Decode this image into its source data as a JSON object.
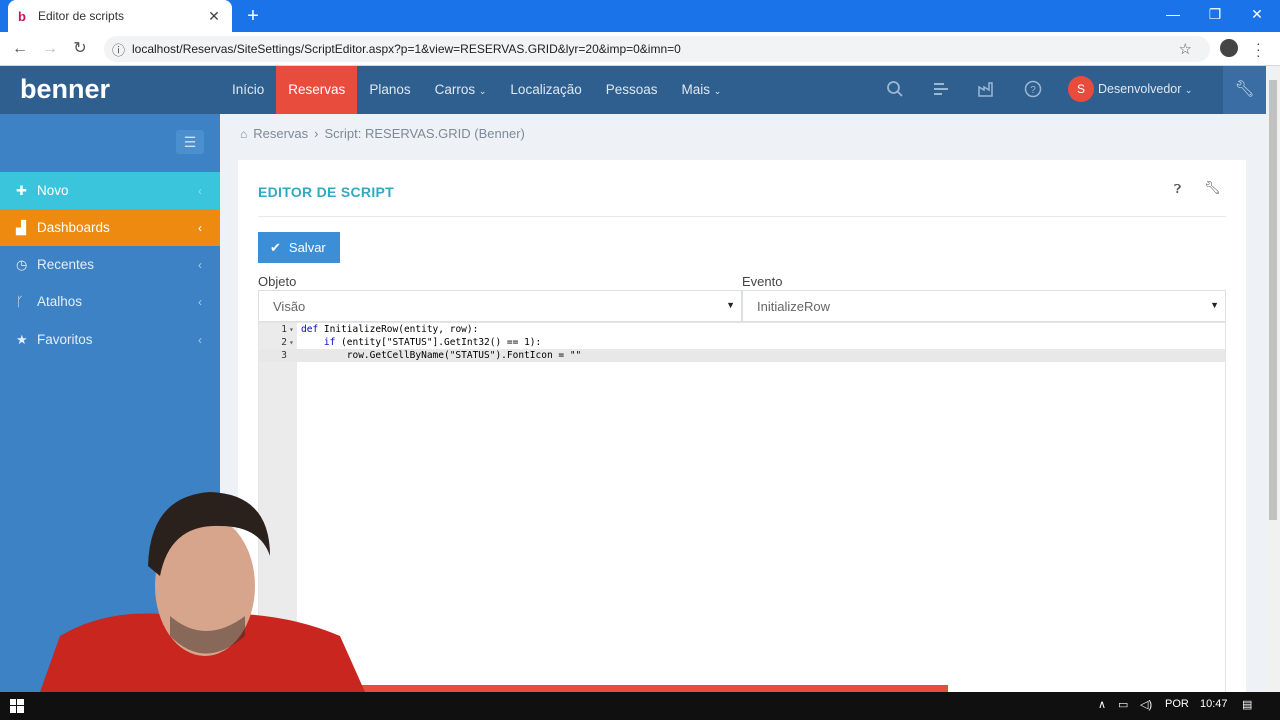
{
  "browser": {
    "tab_title": "Editor de scripts",
    "favicon": "b",
    "url": "localhost/Reservas/SiteSettings/ScriptEditor.aspx?p=1&view=RESERVAS.GRID&lyr=20&imp=0&imn=0"
  },
  "app": {
    "logo": "benner",
    "nav": [
      "Início",
      "Reservas",
      "Planos",
      "Carros",
      "Localização",
      "Pessoas",
      "Mais"
    ],
    "active_nav": "Reservas",
    "user_initial": "S",
    "user_name": "Desenvolvedor",
    "colors": {
      "header": "#2f5f8f",
      "active_nav": "#e84c3d",
      "sidebar": "#3c82c4",
      "novo": "#3bc5dc",
      "dashboards": "#ee8a0f",
      "title": "#33a8c0",
      "save": "#3c8fd6"
    }
  },
  "sidebar": {
    "items": [
      {
        "label": "Novo",
        "icon": "plus-icon"
      },
      {
        "label": "Dashboards",
        "icon": "bar-chart-icon"
      },
      {
        "label": "Recentes",
        "icon": "clock-icon"
      },
      {
        "label": "Atalhos",
        "icon": "fork-icon"
      },
      {
        "label": "Favoritos",
        "icon": "star-icon"
      }
    ]
  },
  "breadcrumb": {
    "home": "Reservas",
    "current": "Script: RESERVAS.GRID (Benner)"
  },
  "panel": {
    "title": "EDITOR DE SCRIPT",
    "save_label": "Salvar",
    "objeto_label": "Objeto",
    "objeto_value": "Visão",
    "evento_label": "Evento",
    "evento_value": "InitializeRow"
  },
  "code_lines": [
    {
      "n": "1",
      "kw": "def",
      "rest": " InitializeRow(entity, row):"
    },
    {
      "n": "2",
      "kw": "    if",
      "rest": " (entity[\"STATUS\"].GetInt32() == 1):"
    },
    {
      "n": "3",
      "kw": "",
      "rest": "        row.GetCellByName(\"STATUS\").FontIcon = \"\""
    }
  ],
  "taskbar": {
    "lang": "POR",
    "time": "10:47"
  }
}
